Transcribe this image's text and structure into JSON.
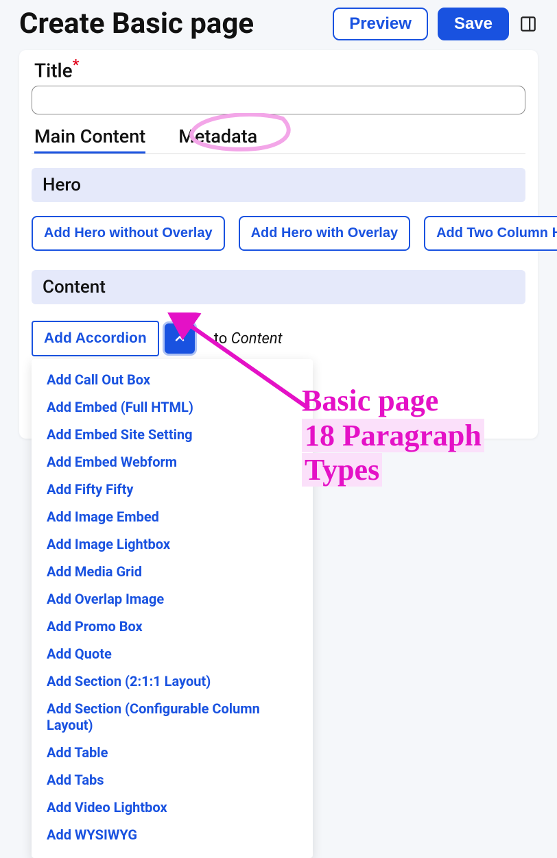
{
  "header": {
    "heading": "Create Basic page",
    "preview": "Preview",
    "save": "Save"
  },
  "form": {
    "title_label": "Title",
    "title_value": ""
  },
  "tabs": {
    "main": "Main Content",
    "meta": "Metadata"
  },
  "sections": {
    "hero_label": "Hero",
    "content_label": "Content"
  },
  "hero_buttons": {
    "b1": "Add Hero without Overlay",
    "b2": "Add Hero with Overlay",
    "b3": "Add Two Column Hero"
  },
  "content_add": {
    "primary": "Add Accordion",
    "to_word": "to",
    "to_target": "Content"
  },
  "dropdown_items": [
    "Add Call Out Box",
    "Add Embed (Full HTML)",
    "Add Embed Site Setting",
    "Add Embed Webform",
    "Add Fifty Fifty",
    "Add Image Embed",
    "Add Image Lightbox",
    "Add Media Grid",
    "Add Overlap Image",
    "Add Promo Box",
    "Add Quote",
    "Add Section (2:1:1 Layout)",
    "Add Section (Configurable Column Layout)",
    "Add Table",
    "Add Tabs",
    "Add Video Lightbox",
    "Add WYSIWYG"
  ],
  "annotation": {
    "line1": "Basic page",
    "line2": "18 Paragraph",
    "line3": "Types"
  }
}
